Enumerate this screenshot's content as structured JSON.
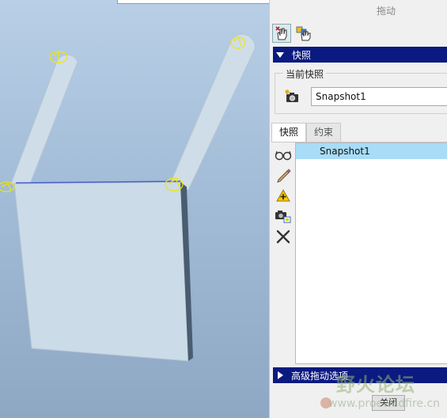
{
  "panel": {
    "title": "拖动",
    "snapshot_section": "快照",
    "current_snapshot_label": "当前快照",
    "current_snapshot_value": "Snapshot1",
    "tabs": [
      {
        "label": "快照",
        "active": true
      },
      {
        "label": "约束",
        "active": false
      }
    ],
    "snapshots": [
      "Snapshot1"
    ],
    "advanced_section": "高级拖动选项",
    "close_label": "关闭"
  },
  "icons": {
    "mode_tools": [
      "point-drag-icon",
      "body-drag-icon"
    ],
    "list_tools": [
      "view-glasses-icon",
      "edit-pencil-icon",
      "add-constraint-icon",
      "capture-snapshot-icon",
      "delete-x-icon"
    ]
  },
  "watermark": {
    "text": "野火论坛",
    "url": "www.proewildfire.cn"
  },
  "colors": {
    "section_header": "#0a1a80",
    "list_selection": "#a8dcf7",
    "viewport_top": "#b8cfe6",
    "viewport_bottom": "#8ea7c4",
    "joint_marker": "#ffee00"
  }
}
